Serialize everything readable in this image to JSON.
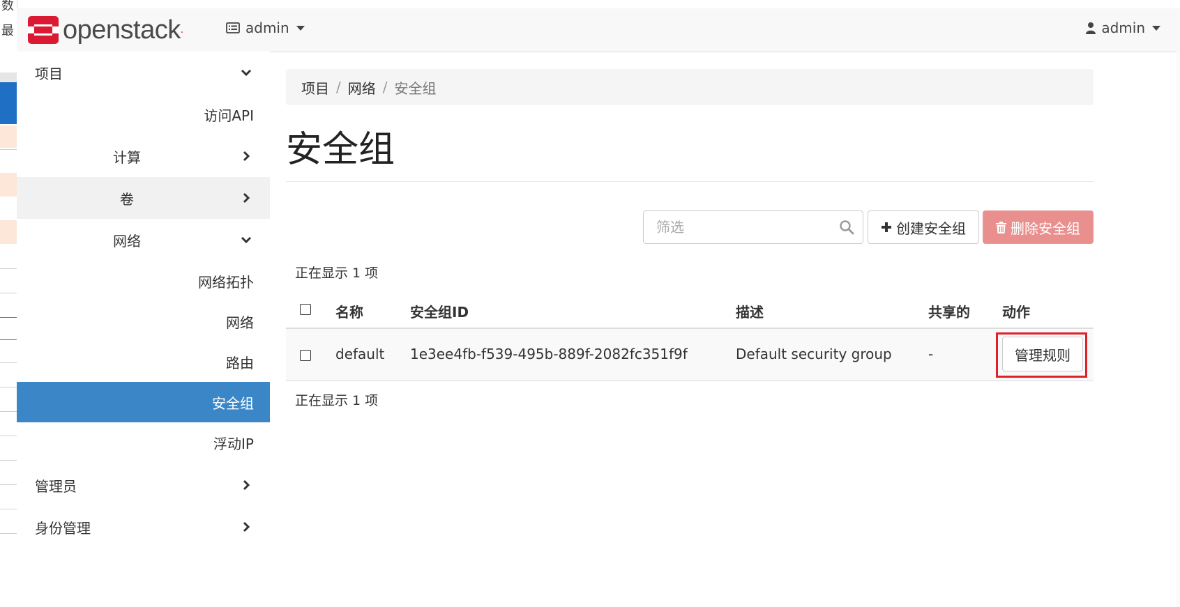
{
  "background": {
    "chars": [
      "数",
      "最"
    ]
  },
  "navbar": {
    "logo_text": "openstack",
    "project_menu": "admin",
    "user_menu": "admin",
    "brand_color": "#da1a32"
  },
  "sidebar": {
    "items": [
      {
        "label": "项目",
        "chevron": "down"
      },
      {
        "label": "访问API"
      },
      {
        "label": "计算",
        "chevron": "right"
      },
      {
        "label": "卷",
        "chevron": "right"
      },
      {
        "label": "网络",
        "chevron": "down"
      },
      {
        "label": "网络拓扑"
      },
      {
        "label": "网络"
      },
      {
        "label": "路由"
      },
      {
        "label": "安全组",
        "active": true
      },
      {
        "label": "浮动IP"
      },
      {
        "label": "管理员",
        "chevron": "right"
      },
      {
        "label": "身份管理",
        "chevron": "right"
      }
    ],
    "active_color": "#3b86c6"
  },
  "breadcrumb": {
    "items": [
      "项目",
      "网络",
      "安全组"
    ],
    "sep": "/"
  },
  "page": {
    "title": "安全组"
  },
  "toolbar": {
    "filter_placeholder": "筛选",
    "create_label": "创建安全组",
    "delete_label": "删除安全组"
  },
  "table": {
    "count_text": "正在显示 1 项",
    "columns": [
      "名称",
      "安全组ID",
      "描述",
      "共享的",
      "动作"
    ],
    "rows": [
      {
        "name": "default",
        "id": "1e3ee4fb-f539-495b-889f-2082fc351f9f",
        "description": "Default security group",
        "shared": "-",
        "action": "管理规则"
      }
    ]
  }
}
